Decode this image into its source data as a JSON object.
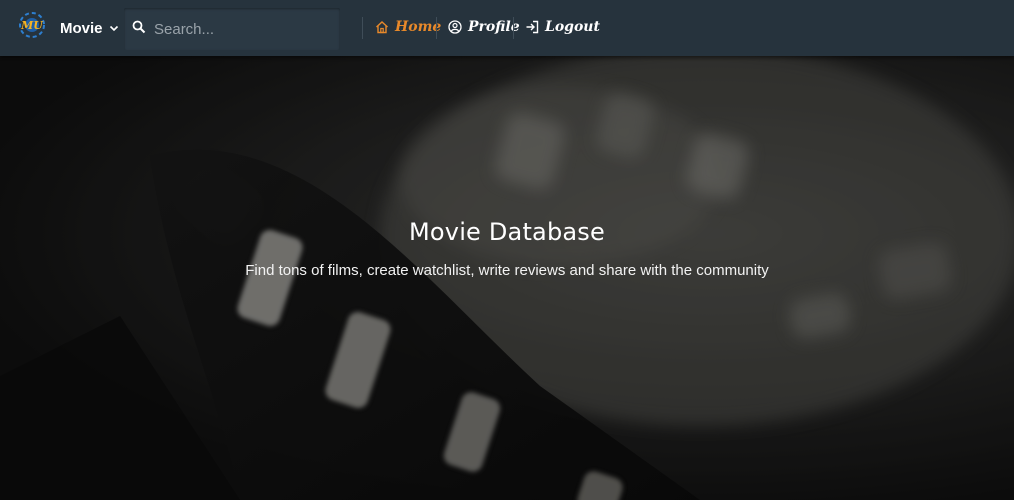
{
  "navbar": {
    "logo_text": "MU",
    "brand_menu_label": "Movie",
    "search": {
      "placeholder": "Search...",
      "value": ""
    },
    "links": [
      {
        "label": "Home",
        "icon": "home-icon",
        "active": true
      },
      {
        "label": "Profile",
        "icon": "user-circle-icon",
        "active": false
      },
      {
        "label": "Logout",
        "icon": "logout-icon",
        "active": false
      }
    ]
  },
  "hero": {
    "title": "Movie Database",
    "subtitle": "Find tons of films, create watchlist, write reviews and share with the community"
  },
  "colors": {
    "navbar_bg": "#26333d",
    "accent": "#e8892a",
    "text": "#ffffff"
  }
}
